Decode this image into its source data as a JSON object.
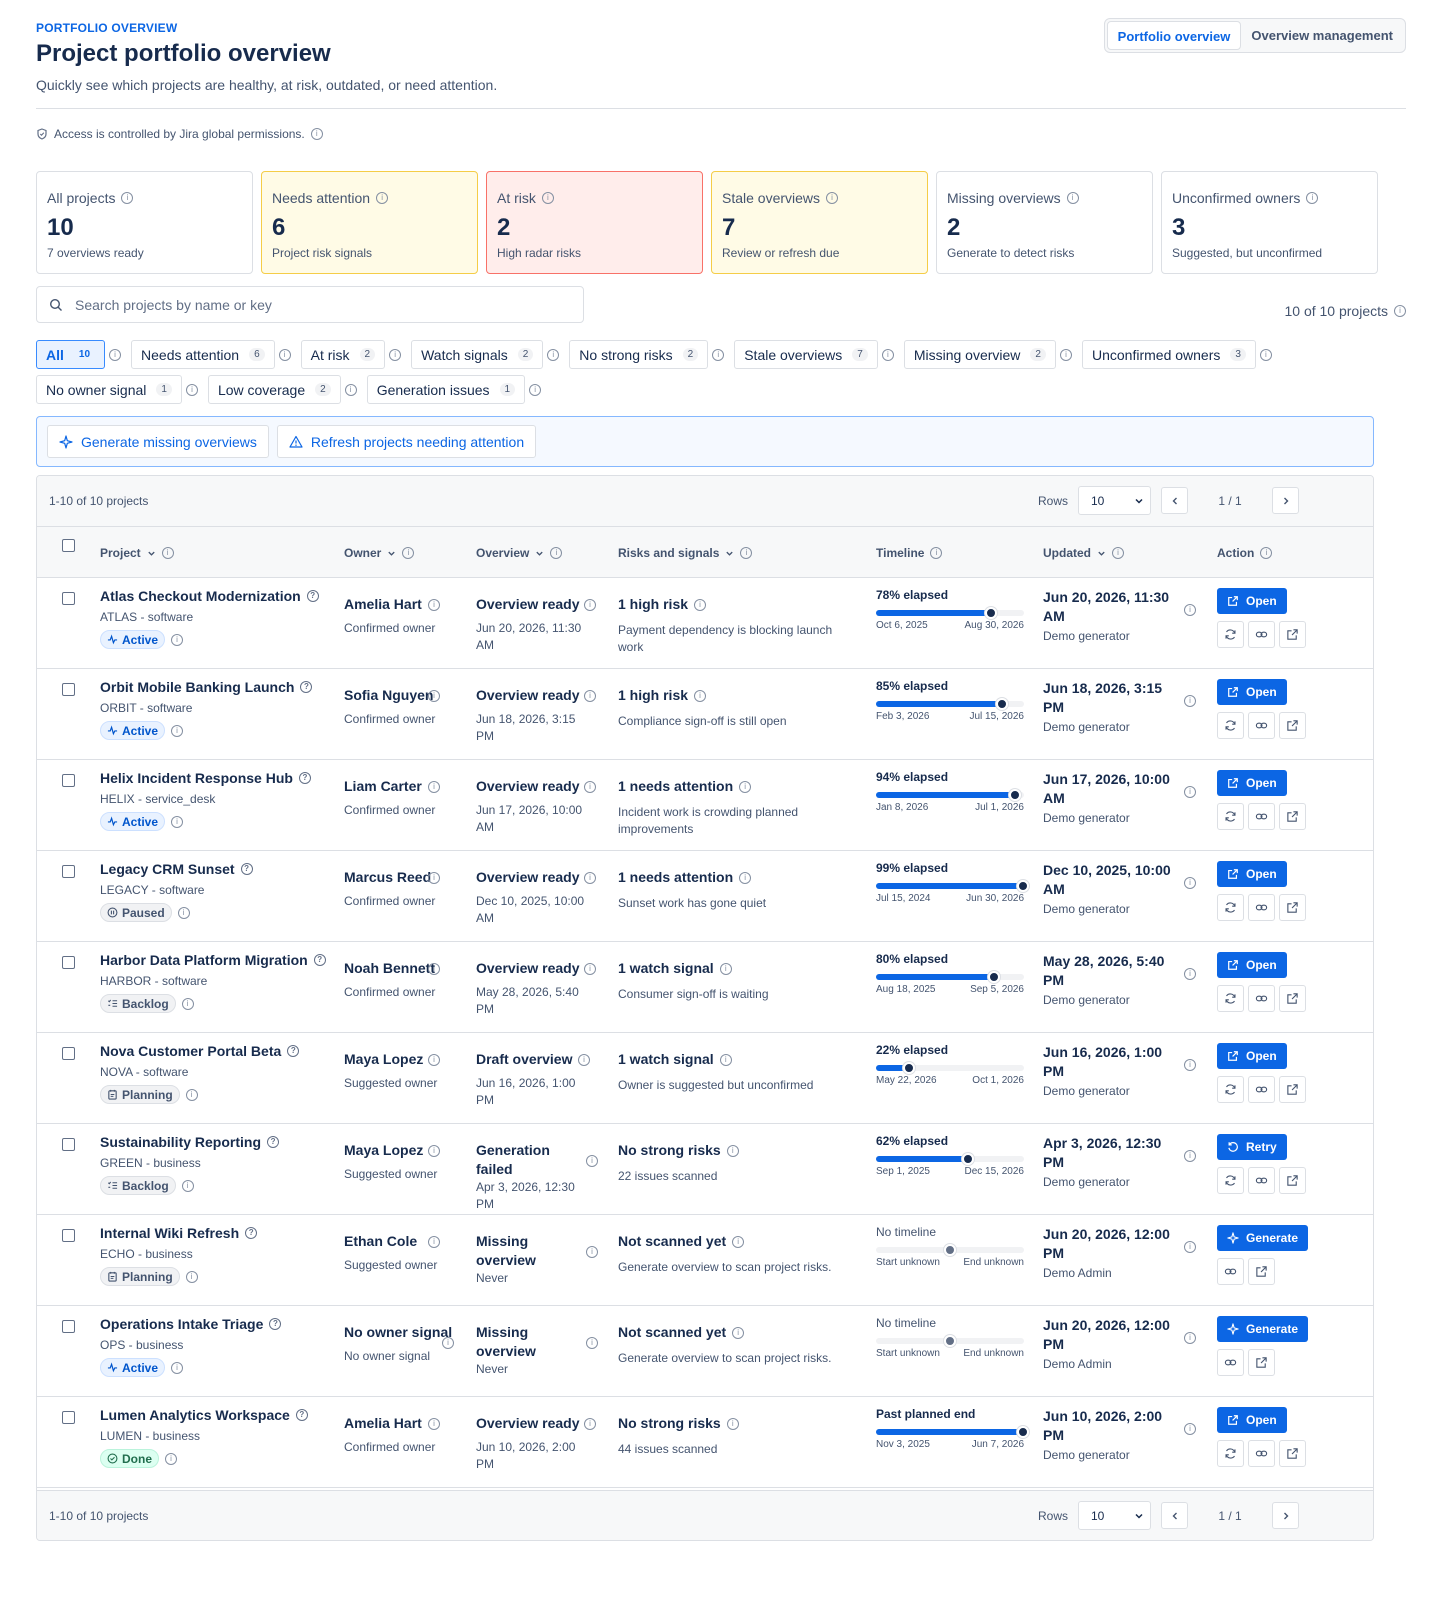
{
  "header": {
    "eyebrow": "PORTFOLIO OVERVIEW",
    "title": "Project portfolio overview",
    "subtitle": "Quickly see which projects are healthy, at risk, outdated, or need attention.",
    "tabs": [
      "Portfolio overview",
      "Overview management"
    ],
    "access_note": "Access is controlled by Jira global permissions."
  },
  "cards": [
    {
      "label": "All projects",
      "value": "10",
      "caption": "7 overviews ready",
      "tone": "neutral"
    },
    {
      "label": "Needs attention",
      "value": "6",
      "caption": "Project risk signals",
      "tone": "warn"
    },
    {
      "label": "At risk",
      "value": "2",
      "caption": "High radar risks",
      "tone": "danger"
    },
    {
      "label": "Stale overviews",
      "value": "7",
      "caption": "Review or refresh due",
      "tone": "warn"
    },
    {
      "label": "Missing overviews",
      "value": "2",
      "caption": "Generate to detect risks",
      "tone": "neutral"
    },
    {
      "label": "Unconfirmed owners",
      "value": "3",
      "caption": "Suggested, but unconfirmed",
      "tone": "neutral"
    }
  ],
  "search": {
    "placeholder": "Search projects by name or key"
  },
  "result_count": "10 of 10 projects",
  "filters": [
    [
      {
        "label": "All",
        "count": "10",
        "active": true
      },
      {
        "label": "Needs attention",
        "count": "6"
      },
      {
        "label": "At risk",
        "count": "2"
      },
      {
        "label": "Watch signals",
        "count": "2"
      },
      {
        "label": "No strong risks",
        "count": "2"
      },
      {
        "label": "Stale overviews",
        "count": "7"
      },
      {
        "label": "Missing overview",
        "count": "2"
      },
      {
        "label": "Unconfirmed owners",
        "count": "3"
      }
    ],
    [
      {
        "label": "No owner signal",
        "count": "1"
      },
      {
        "label": "Low coverage",
        "count": "2"
      },
      {
        "label": "Generation issues",
        "count": "1"
      }
    ]
  ],
  "bulk_actions": [
    "Generate missing overviews",
    "Refresh projects needing attention"
  ],
  "pager": {
    "range": "1-10 of 10 projects",
    "rows_label": "Rows",
    "rows_value": "10",
    "page": "1 / 1"
  },
  "columns": [
    "Project",
    "Owner",
    "Overview",
    "Risks and signals",
    "Timeline",
    "Updated",
    "Action"
  ],
  "rows": [
    {
      "name": "Atlas Checkout Modernization",
      "key": "ATLAS - software",
      "status": "Active",
      "owner": "Amelia Hart",
      "owner_sub": "Confirmed owner",
      "overview": "Overview ready",
      "overview_sub": "Jun 20, 2026, 11:30 AM",
      "risk": "1 high risk",
      "risk_sub": "Payment dependency is blocking launch work",
      "tl_label": "78% elapsed",
      "tl_pct": 78,
      "tl_start": "Oct 6, 2025",
      "tl_end": "Aug 30, 2026",
      "updated": "Jun 20, 2026, 11:30 AM",
      "updated_by": "Demo generator",
      "action": "Open"
    },
    {
      "name": "Orbit Mobile Banking Launch",
      "key": "ORBIT - software",
      "status": "Active",
      "owner": "Sofia Nguyen",
      "owner_sub": "Confirmed owner",
      "overview": "Overview ready",
      "overview_sub": "Jun 18, 2026, 3:15 PM",
      "risk": "1 high risk",
      "risk_sub": "Compliance sign-off is still open",
      "tl_label": "85% elapsed",
      "tl_pct": 85,
      "tl_start": "Feb 3, 2026",
      "tl_end": "Jul 15, 2026",
      "updated": "Jun 18, 2026, 3:15 PM",
      "updated_by": "Demo generator",
      "action": "Open"
    },
    {
      "name": "Helix Incident Response Hub",
      "key": "HELIX - service_desk",
      "status": "Active",
      "owner": "Liam Carter",
      "owner_sub": "Confirmed owner",
      "overview": "Overview ready",
      "overview_sub": "Jun 17, 2026, 10:00 AM",
      "risk": "1 needs attention",
      "risk_sub": "Incident work is crowding planned improvements",
      "tl_label": "94% elapsed",
      "tl_pct": 94,
      "tl_start": "Jan 8, 2026",
      "tl_end": "Jul 1, 2026",
      "updated": "Jun 17, 2026, 10:00 AM",
      "updated_by": "Demo generator",
      "action": "Open"
    },
    {
      "name": "Legacy CRM Sunset",
      "key": "LEGACY - software",
      "status": "Paused",
      "owner": "Marcus Reed",
      "owner_sub": "Confirmed owner",
      "overview": "Overview ready",
      "overview_sub": "Dec 10, 2025, 10:00 AM",
      "risk": "1 needs attention",
      "risk_sub": "Sunset work has gone quiet",
      "tl_label": "99% elapsed",
      "tl_pct": 99,
      "tl_start": "Jul 15, 2024",
      "tl_end": "Jun 30, 2026",
      "updated": "Dec 10, 2025, 10:00 AM",
      "updated_by": "Demo generator",
      "action": "Open"
    },
    {
      "name": "Harbor Data Platform Migration",
      "key": "HARBOR - software",
      "status": "Backlog",
      "owner": "Noah Bennett",
      "owner_sub": "Confirmed owner",
      "overview": "Overview ready",
      "overview_sub": "May 28, 2026, 5:40 PM",
      "risk": "1 watch signal",
      "risk_sub": "Consumer sign-off is waiting",
      "tl_label": "80% elapsed",
      "tl_pct": 80,
      "tl_start": "Aug 18, 2025",
      "tl_end": "Sep 5, 2026",
      "updated": "May 28, 2026, 5:40 PM",
      "updated_by": "Demo generator",
      "action": "Open"
    },
    {
      "name": "Nova Customer Portal Beta",
      "key": "NOVA - software",
      "status": "Planning",
      "owner": "Maya Lopez",
      "owner_sub": "Suggested owner",
      "overview": "Draft overview",
      "overview_sub": "Jun 16, 2026, 1:00 PM",
      "risk": "1 watch signal",
      "risk_sub": "Owner is suggested but unconfirmed",
      "tl_label": "22% elapsed",
      "tl_pct": 22,
      "tl_start": "May 22, 2026",
      "tl_end": "Oct 1, 2026",
      "updated": "Jun 16, 2026, 1:00 PM",
      "updated_by": "Demo generator",
      "action": "Open"
    },
    {
      "name": "Sustainability Reporting",
      "key": "GREEN - business",
      "status": "Backlog",
      "owner": "Maya Lopez",
      "owner_sub": "Suggested owner",
      "overview": "Generation failed",
      "overview_sub": "Apr 3, 2026, 12:30 PM",
      "risk": "No strong risks",
      "risk_sub": "22 issues scanned",
      "tl_label": "62% elapsed",
      "tl_pct": 62,
      "tl_start": "Sep 1, 2025",
      "tl_end": "Dec 15, 2026",
      "updated": "Apr 3, 2026, 12:30 PM",
      "updated_by": "Demo generator",
      "action": "Retry"
    },
    {
      "name": "Internal Wiki Refresh",
      "key": "ECHO - business",
      "status": "Planning",
      "owner": "Ethan Cole",
      "owner_sub": "Suggested owner",
      "overview": "Missing overview",
      "overview_sub": "Never",
      "risk": "Not scanned yet",
      "risk_sub": "Generate overview to scan project risks.",
      "tl_label": "No timeline",
      "tl_pct": 50,
      "tl_start": "Start unknown",
      "tl_end": "End unknown",
      "updated": "Jun 20, 2026, 12:00 PM",
      "updated_by": "Demo Admin",
      "action": "Generate"
    },
    {
      "name": "Operations Intake Triage",
      "key": "OPS - business",
      "status": "Active",
      "owner": "No owner signal",
      "owner_sub": "No owner signal",
      "overview": "Missing overview",
      "overview_sub": "Never",
      "risk": "Not scanned yet",
      "risk_sub": "Generate overview to scan project risks.",
      "tl_label": "No timeline",
      "tl_pct": 50,
      "tl_start": "Start unknown",
      "tl_end": "End unknown",
      "updated": "Jun 20, 2026, 12:00 PM",
      "updated_by": "Demo Admin",
      "action": "Generate"
    },
    {
      "name": "Lumen Analytics Workspace",
      "key": "LUMEN - business",
      "status": "Done",
      "owner": "Amelia Hart",
      "owner_sub": "Confirmed owner",
      "overview": "Overview ready",
      "overview_sub": "Jun 10, 2026, 2:00 PM",
      "risk": "No strong risks",
      "risk_sub": "44 issues scanned",
      "tl_label": "Past planned end",
      "tl_pct": 100,
      "tl_start": "Nov 3, 2025",
      "tl_end": "Jun 7, 2026",
      "updated": "Jun 10, 2026, 2:00 PM",
      "updated_by": "Demo generator",
      "action": "Open"
    }
  ]
}
